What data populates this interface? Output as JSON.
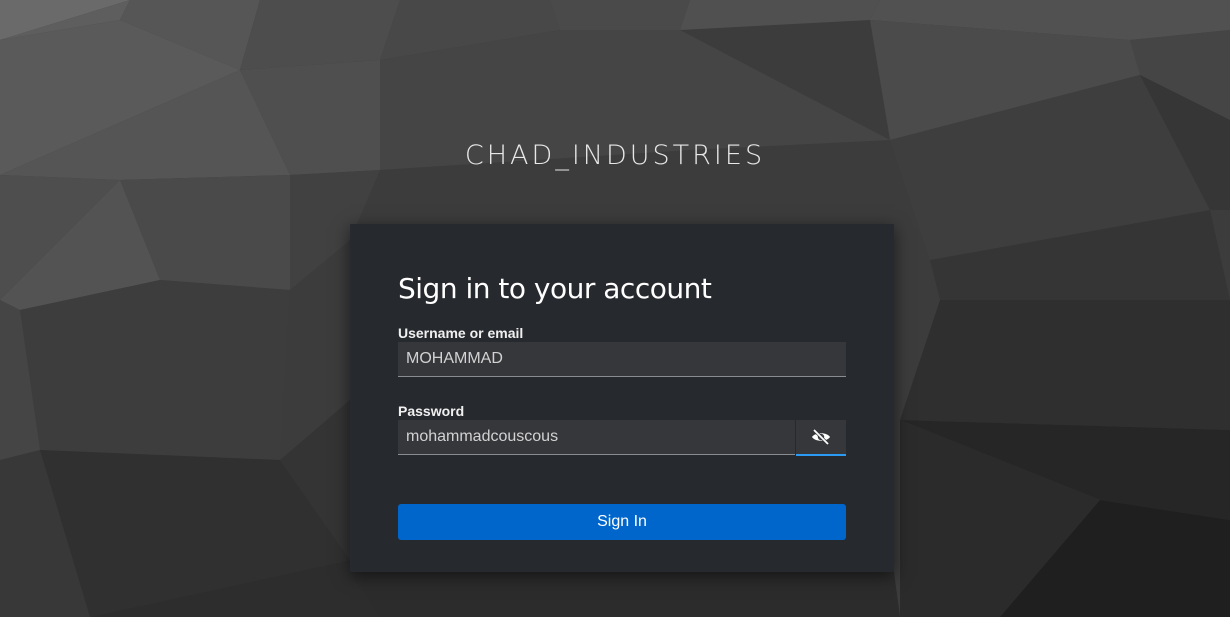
{
  "realm": {
    "title": "CHAD_INDUSTRIES"
  },
  "login_card": {
    "heading": "Sign in to your account",
    "username": {
      "label": "Username or email",
      "value": "MOHAMMAD"
    },
    "password": {
      "label": "Password",
      "value": "mohammadcouscous",
      "visible": true
    },
    "show_password_icon": "eye-slash-icon",
    "submit_label": "Sign In"
  },
  "colors": {
    "card_background": "#26292d",
    "input_background": "#36373b",
    "primary_button": "#0066cc",
    "focus_accent": "#2b9af3"
  }
}
